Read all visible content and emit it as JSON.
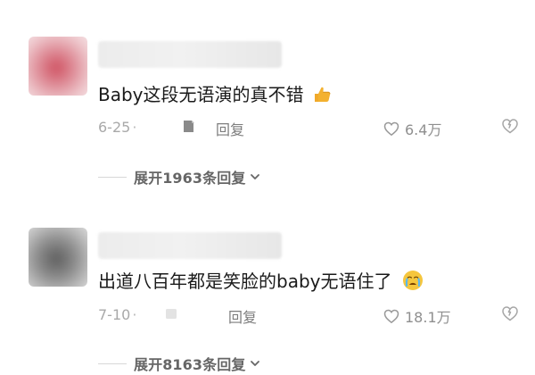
{
  "comments": [
    {
      "text": "Baby这段无语演的真不错",
      "date": "6-25",
      "dot": "·",
      "reply_label": "回复",
      "likes": "6.4万",
      "expand_label": "展开1963条回复",
      "avatar_icon": "blurred-avatar",
      "emoji_icon": "thumbs-up-icon"
    },
    {
      "text": "出道八百年都是笑脸的baby无语住了",
      "date": "7-10",
      "dot": "·",
      "reply_label": "回复",
      "likes": "18.1万",
      "expand_label": "展开8163条回复",
      "avatar_icon": "blurred-avatar",
      "emoji_icon": "crying-face-icon"
    }
  ],
  "colors": {
    "text_primary": "#1a1a1a",
    "text_secondary": "#a8a8a8",
    "text_reply": "#7d7d7d",
    "text_expand": "#666666",
    "like_icon": "#9a9a9a",
    "emoji_yellow": "#f3b12f",
    "emoji_blue": "#59b8f5"
  }
}
